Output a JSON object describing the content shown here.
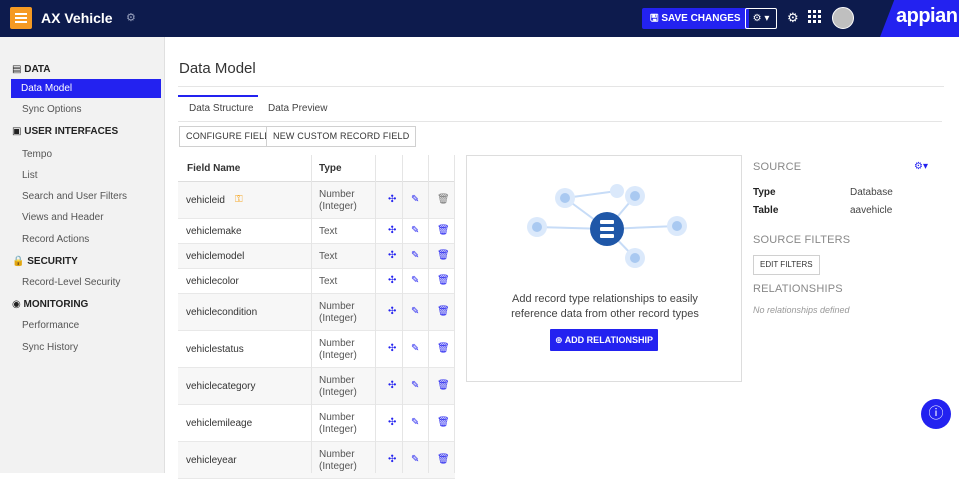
{
  "header": {
    "app_title": "AX Vehicle",
    "title_icon": "gear-icon",
    "save_label": "SAVE CHANGES",
    "save_icon": "save-icon",
    "settings_icon": "gear-icon",
    "settings_caret": "caret-down-icon",
    "extra_icon": "tools-icon",
    "apps_icon": "grid-icon",
    "brand": "appian",
    "colors": {
      "bar": "#0d1b4d",
      "accent": "#2322f0",
      "app_icon": "#f59a23"
    }
  },
  "sidebar": {
    "sections": [
      {
        "title": "DATA",
        "icon": "database-icon",
        "items": [
          "Data Model",
          "Sync Options"
        ]
      },
      {
        "title": "USER INTERFACES",
        "icon": "interface-icon",
        "items": [
          "Tempo",
          "List",
          "Search and User Filters",
          "Views and Header",
          "Record Actions"
        ]
      },
      {
        "title": "SECURITY",
        "icon": "lock-icon",
        "items": [
          "Record-Level Security"
        ]
      },
      {
        "title": "MONITORING",
        "icon": "monitor-icon",
        "items": [
          "Performance",
          "Sync History"
        ]
      }
    ],
    "active_item": "Data Model"
  },
  "main": {
    "title": "Data Model",
    "tabs": [
      "Data Structure",
      "Data Preview"
    ],
    "active_tab": "Data Structure",
    "buttons": [
      "CONFIGURE FIELDS",
      "NEW CUSTOM RECORD FIELD"
    ],
    "grid": {
      "headers": [
        "Field Name",
        "Type"
      ],
      "rows": [
        {
          "name": "vehicleid",
          "type": "Number (Integer)",
          "key": true
        },
        {
          "name": "vehiclemake",
          "type": "Text"
        },
        {
          "name": "vehiclemodel",
          "type": "Text"
        },
        {
          "name": "vehiclecolor",
          "type": "Text"
        },
        {
          "name": "vehiclecondition",
          "type": "Number (Integer)"
        },
        {
          "name": "vehiclestatus",
          "type": "Number (Integer)"
        },
        {
          "name": "vehiclecategory",
          "type": "Number (Integer)"
        },
        {
          "name": "vehiclemileage",
          "type": "Number (Integer)"
        },
        {
          "name": "vehicleyear",
          "type": "Number (Integer)"
        }
      ],
      "row_icons": [
        "relationship-icon",
        "pencil-icon",
        "trash-icon"
      ]
    },
    "relationships_panel": {
      "text_line1": "Add record type relationships to easily",
      "text_line2": "reference data from other record types",
      "add_label": "ADD RELATIONSHIP",
      "add_icon": "plus-circle-icon"
    }
  },
  "right_panel": {
    "source_title": "SOURCE",
    "type_label": "Type",
    "type_value": "Database",
    "table_label": "Table",
    "table_value": "aavehicle",
    "source_filters_title": "SOURCE FILTERS",
    "edit_filters_label": "EDIT FILTERS",
    "relationships_title": "RELATIONSHIPS",
    "relationships_empty": "No relationships defined"
  },
  "help_icon": "help-icon"
}
